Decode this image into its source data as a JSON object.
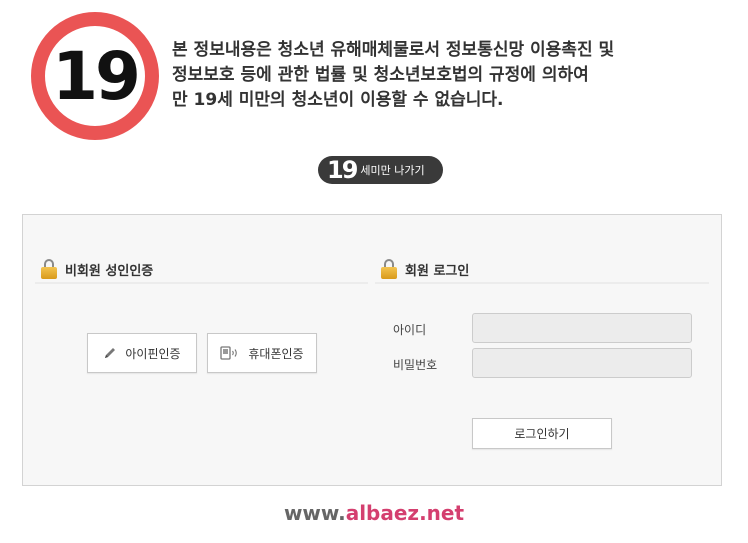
{
  "age_badge": {
    "number": "19"
  },
  "notice": {
    "lines": [
      "본 정보내용은 청소년 유해매체물로서 정보통신망 이용촉진 및",
      "정보보호 등에 관한 법률 및 청소년보호법의 규정에 의하여",
      "만 19세 미만의 청소년이 이용할 수 없습니다."
    ]
  },
  "exit_button": {
    "number": "19",
    "label": "세미만 나가기"
  },
  "adult_auth": {
    "title": "비회원 성인인증",
    "ipin_label": "아이핀인증",
    "phone_label": "휴대폰인증"
  },
  "member_login": {
    "title": "회원 로그인",
    "id_label": "아이디",
    "password_label": "비밀번호",
    "id_value": "",
    "password_value": "",
    "submit_label": "로그인하기"
  },
  "footer": {
    "www": "www.",
    "domain": "albaez.net"
  },
  "colors": {
    "badge_ring": "#ea5454",
    "pill_bg": "#3a3a3a",
    "domain_accent": "#d43f6f",
    "lock_gold": "#e0aa2c"
  },
  "icons": {
    "section_icon": "lock-icon",
    "ipin_icon": "pencil-icon",
    "phone_icon": "mobile-phone-icon"
  }
}
